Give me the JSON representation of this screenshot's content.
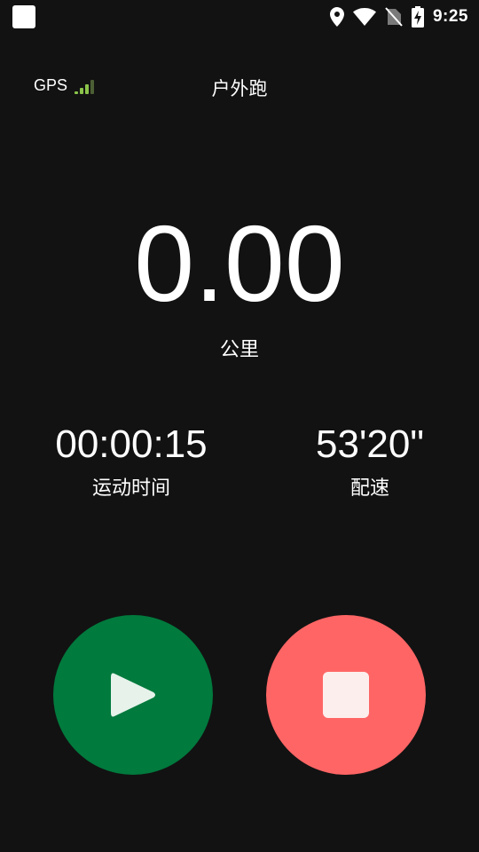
{
  "status_bar": {
    "time": "9:25",
    "icons": [
      "app-square-icon",
      "location-pin-icon",
      "wifi-icon",
      "no-sim-icon",
      "battery-charging-icon"
    ]
  },
  "header": {
    "gps_label": "GPS",
    "gps_signal_icon": "signal-bars-icon",
    "title": "户外跑"
  },
  "distance": {
    "value": "0.00",
    "unit": "公里"
  },
  "stats": {
    "duration_value": "00:00:15",
    "duration_label": "运动时间",
    "pace_value": "53'20\"",
    "pace_label": "配速"
  },
  "controls": {
    "start_icon": "play-icon",
    "stop_icon": "stop-icon",
    "start_color": "#007a3d",
    "stop_color": "#ff6565"
  },
  "colors": {
    "background": "#121212",
    "gps_signal": "#8bc34a"
  }
}
